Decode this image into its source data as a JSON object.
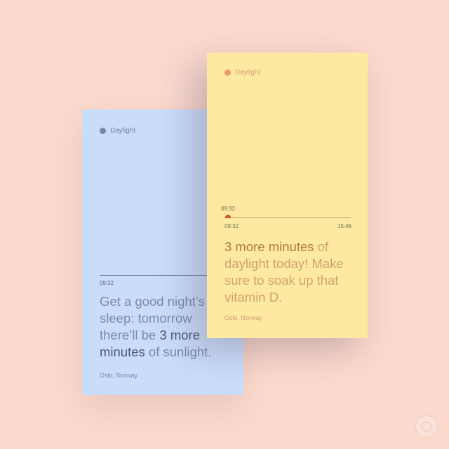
{
  "background_color": "#fcd9cd",
  "card_left": {
    "color": "#c9dcfa",
    "brand": "Daylight",
    "time": "09:32",
    "message_part1": "Get a good night’s sleep: tomorrow there’ll be ",
    "message_highlight": "3 more minutes",
    "message_part2": " of sunlight.",
    "location": "Oslo, Norway"
  },
  "card_right": {
    "color": "#fdeaa0",
    "brand": "Daylight",
    "current_time": "09:32",
    "progress_start": "09:32",
    "progress_end": "15:46",
    "progress_fraction": 0.03,
    "message_highlight": "3 more minutes",
    "message_part1": " of daylight today! Make sure to soak up that vitamin D.",
    "location": "Oslo, Norway"
  },
  "watermark_icon": "logo-mark-icon"
}
